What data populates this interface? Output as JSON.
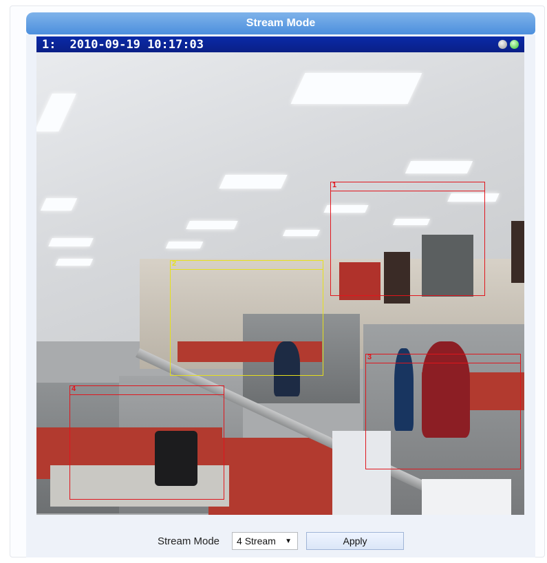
{
  "panel": {
    "title": "Stream Mode"
  },
  "video": {
    "camera_index": "1:",
    "timestamp": "2010-09-19 10:17:03"
  },
  "zones": [
    {
      "tag": "1",
      "color": "#e0151c"
    },
    {
      "tag": "2",
      "color": "#e6e01c"
    },
    {
      "tag": "3",
      "color": "#e0151c"
    },
    {
      "tag": "4",
      "color": "#e0151c"
    }
  ],
  "controls": {
    "label": "Stream Mode",
    "select_value": "4 Stream",
    "apply_label": "Apply"
  },
  "colors": {
    "title_bar": "#4c8fdd",
    "video_header": "#0a1f86",
    "status_gray": "#9a9a9a",
    "status_green": "#2fc02a"
  },
  "icons": [
    "status-gray-icon",
    "status-green-icon",
    "dropdown-caret-icon"
  ]
}
